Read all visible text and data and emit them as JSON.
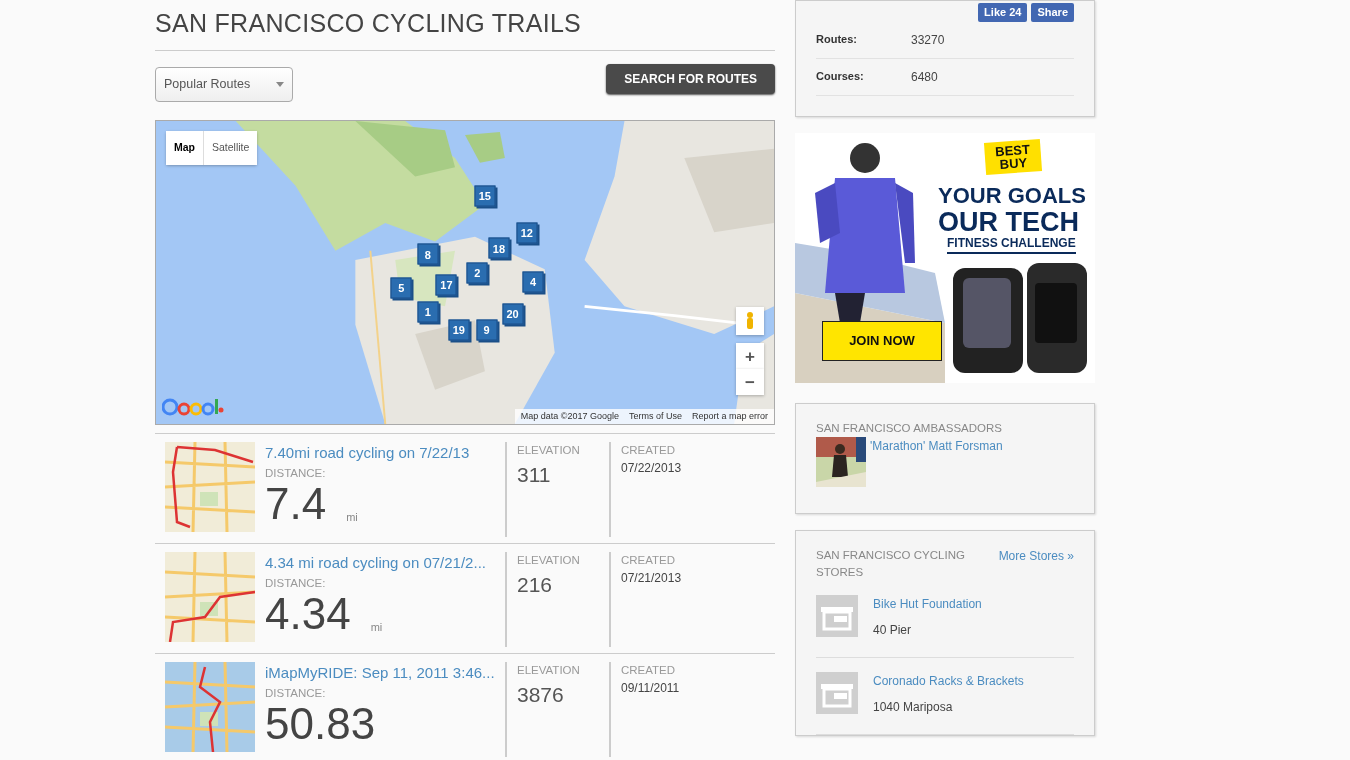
{
  "page_title": "SAN FRANCISCO CYCLING TRAILS",
  "route_filter": {
    "value": "Popular Routes"
  },
  "search_button": "SEARCH FOR ROUTES",
  "map": {
    "map_types": [
      {
        "label": "Map",
        "selected": true
      },
      {
        "label": "Satellite",
        "selected": false
      }
    ],
    "markers": [
      {
        "label": "15"
      },
      {
        "label": "12"
      },
      {
        "label": "8"
      },
      {
        "label": "18"
      },
      {
        "label": "2"
      },
      {
        "label": "17"
      },
      {
        "label": "4"
      },
      {
        "label": "5"
      },
      {
        "label": "1"
      },
      {
        "label": "20"
      },
      {
        "label": "19"
      },
      {
        "label": "9"
      }
    ],
    "zoom_in": "+",
    "zoom_out": "−",
    "attribution": "Map data ©2017 Google",
    "terms_link": "Terms of Use",
    "report_link": "Report a map error"
  },
  "routes": [
    {
      "title": "7.40mi road cycling on 7/22/13",
      "distance_label": "DISTANCE:",
      "distance": "7.4",
      "unit": "mi",
      "elevation_label": "ELEVATION",
      "elevation": "311",
      "created_label": "CREATED",
      "created": "07/22/2013"
    },
    {
      "title": "4.34 mi road cycling on 07/21/2...",
      "distance_label": "DISTANCE:",
      "distance": "4.34",
      "unit": "mi",
      "elevation_label": "ELEVATION",
      "elevation": "216",
      "created_label": "CREATED",
      "created": "07/21/2013"
    },
    {
      "title": "iMapMyRIDE: Sep 11, 2011 3:46...",
      "distance_label": "DISTANCE:",
      "distance": "50.83",
      "elevation_label": "ELEVATION",
      "elevation": "3876",
      "created_label": "CREATED",
      "created": "09/11/2011"
    }
  ],
  "stats": {
    "like_button": "Like 24",
    "share_button": "Share",
    "rows": [
      {
        "label": "Routes:",
        "value": "33270"
      },
      {
        "label": "Courses:",
        "value": "6480"
      }
    ]
  },
  "ad": {
    "logo": "BEST BUY",
    "headline_1": "YOUR GOALS",
    "headline_2": "OUR TECH",
    "subhead": "FITNESS CHALLENGE",
    "cta": "JOIN NOW"
  },
  "ambassadors": {
    "heading": "SAN FRANCISCO AMBASSADORS",
    "people": [
      {
        "name": "'Marathon' Matt Forsman"
      }
    ]
  },
  "stores": {
    "heading": "SAN FRANCISCO CYCLING STORES",
    "more_link": "More Stores »",
    "items": [
      {
        "name": "Bike Hut Foundation",
        "address": "40 Pier"
      },
      {
        "name": "Coronado Racks & Brackets",
        "address": "1040 Mariposa"
      }
    ]
  }
}
